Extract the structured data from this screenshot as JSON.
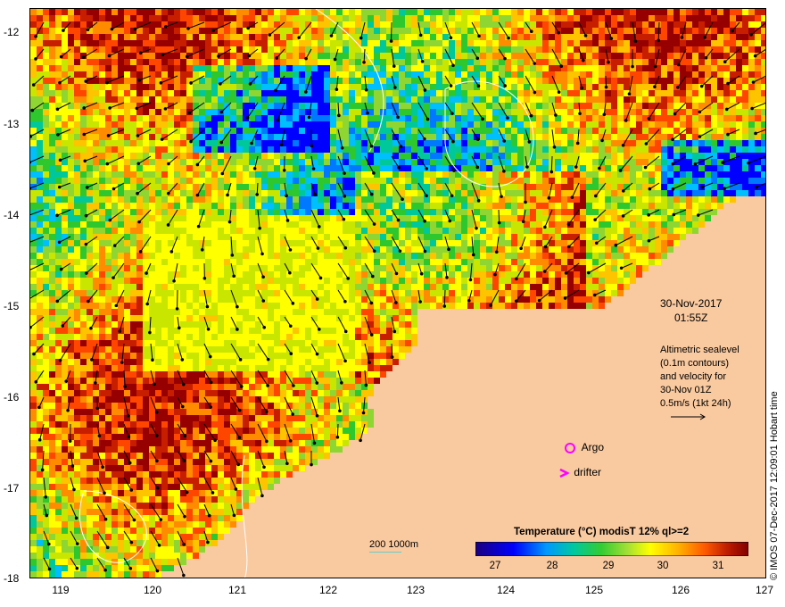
{
  "map": {
    "title_date": "30-Nov-2017",
    "title_time": "01:55Z",
    "y_axis_labels": [
      "-12",
      "-13",
      "-14",
      "-15",
      "-16",
      "-17",
      "-18"
    ],
    "x_axis_labels": [
      "119",
      "120",
      "121",
      "122",
      "123",
      "124",
      "125",
      "126",
      "127"
    ],
    "altimetry_note_lines": [
      "Altimetric sealevel",
      "(0.1m contours)",
      "and velocity for",
      "30-Nov 01Z",
      "0.5m/s (1kt 24h)"
    ],
    "argo_label": "Argo",
    "drifter_label": "drifter",
    "bathymetry_legend": "200  1000m",
    "colorbar_title": "Temperature (°C) modisT 12% ql>=2",
    "colorbar_ticks": [
      "27",
      "28",
      "29",
      "30",
      "31"
    ],
    "credit": "© IMOS 07-Dec-2017 12:09:01 Hobart time",
    "colors": {
      "land": "#f9c99f",
      "argo": "#ff00ff",
      "drifter": "#ff00ff",
      "bathy": "#66cccc"
    }
  }
}
